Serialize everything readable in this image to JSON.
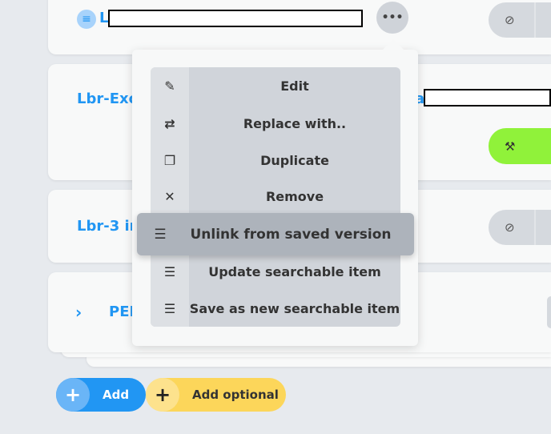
{
  "cards": [
    {
      "title": "L",
      "icon": "database-icon"
    },
    {
      "title": "Lbr-Exc",
      "title_tail": "a"
    },
    {
      "title": "Lbr-3 ir"
    },
    {
      "title": "PEI"
    }
  ],
  "more_label": "•••",
  "menu": {
    "items": [
      {
        "label": "Edit",
        "icon": "pencil-icon",
        "glyph": "✎"
      },
      {
        "label": "Replace with..",
        "icon": "swap-icon",
        "glyph": "⇄"
      },
      {
        "label": "Duplicate",
        "icon": "copy-icon",
        "glyph": "❐"
      },
      {
        "label": "Remove",
        "icon": "close-icon",
        "glyph": "✕"
      },
      {
        "label": "Unlink from saved version",
        "icon": "database-unlink-icon",
        "glyph": "☰"
      },
      {
        "label": "Update searchable item",
        "icon": "database-icon",
        "glyph": "☰"
      },
      {
        "label": "Save as new searchable item",
        "icon": "database-add-icon",
        "glyph": "☰"
      }
    ],
    "highlighted": "Unlink from saved version"
  },
  "buttons": {
    "add": "Add",
    "add_optional": "Add optional",
    "plus": "+"
  },
  "colors": {
    "accent": "#2196f3",
    "green": "#90f23a",
    "yellow": "#fcd65a",
    "menu_bg": "#d0d4da",
    "highlight": "#adb3bb"
  }
}
